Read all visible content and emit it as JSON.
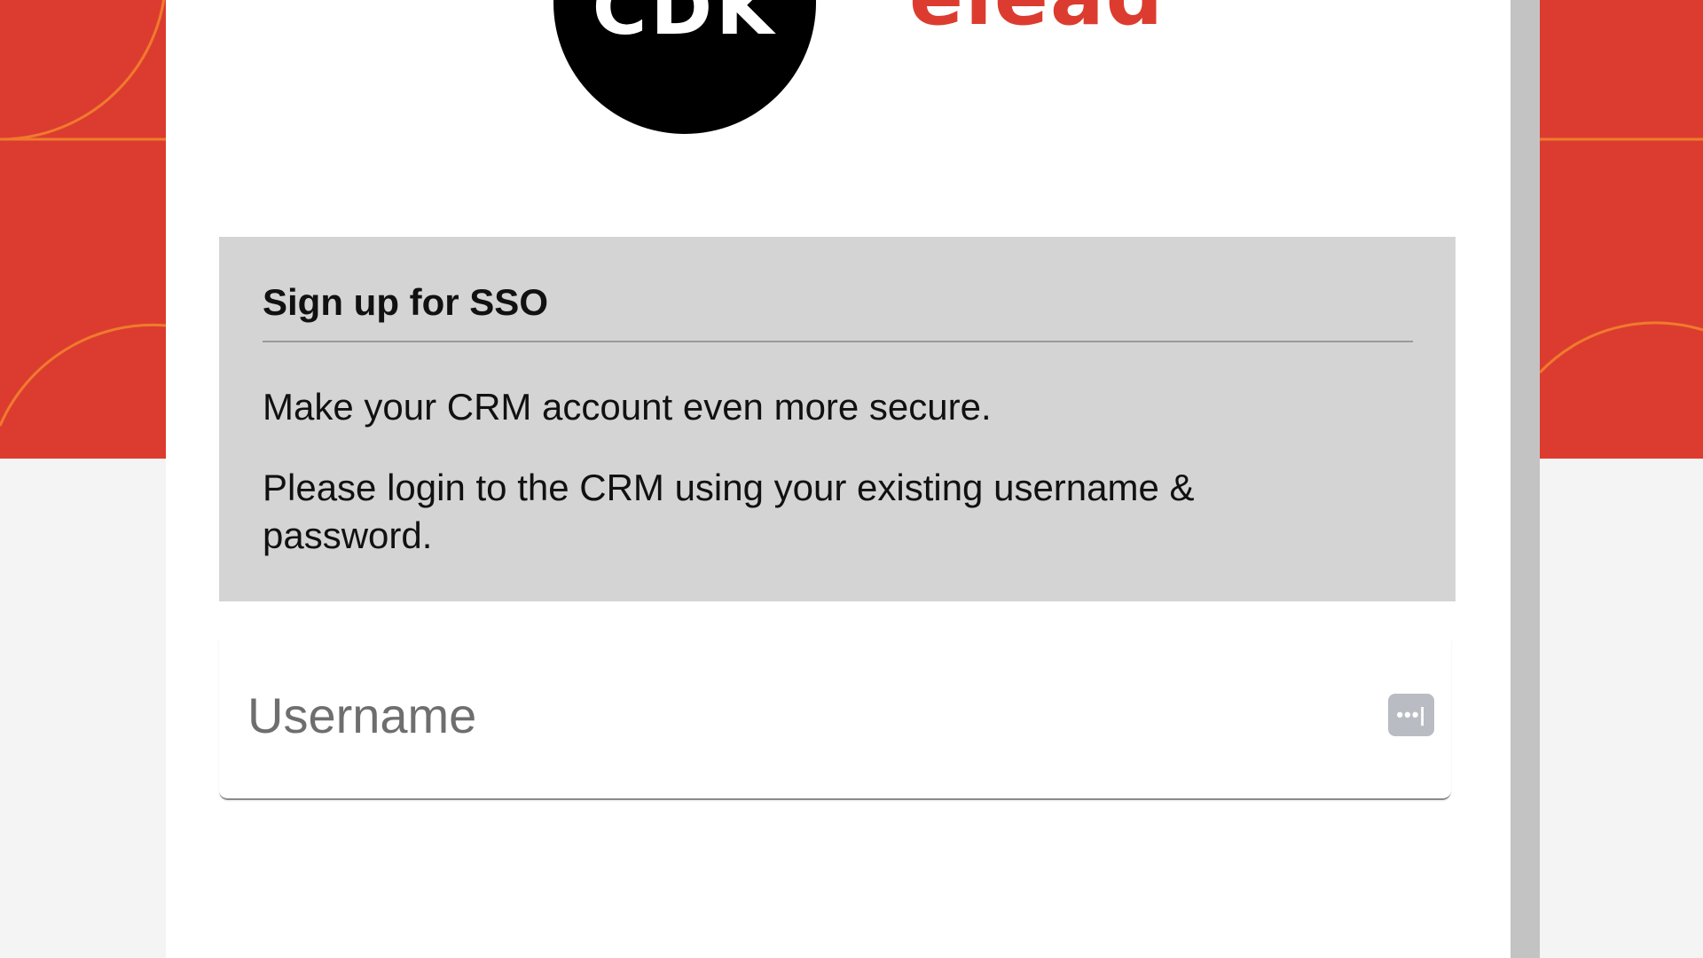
{
  "logos": {
    "cdk": "CDK",
    "elead": "elead"
  },
  "sso_notice": {
    "title": "Sign up for SSO",
    "line1": "Make your CRM account even more secure.",
    "line2": "Please login to the CRM using your existing username & password."
  },
  "login_form": {
    "username_placeholder": "Username",
    "username_value": ""
  },
  "icons": {
    "password_manager": "password-manager-icon"
  },
  "colors": {
    "brand_red": "#dc3c2f",
    "accent_orange": "#f07a2e",
    "notice_bg": "#d4d4d4",
    "page_bg": "#f4f4f4"
  }
}
